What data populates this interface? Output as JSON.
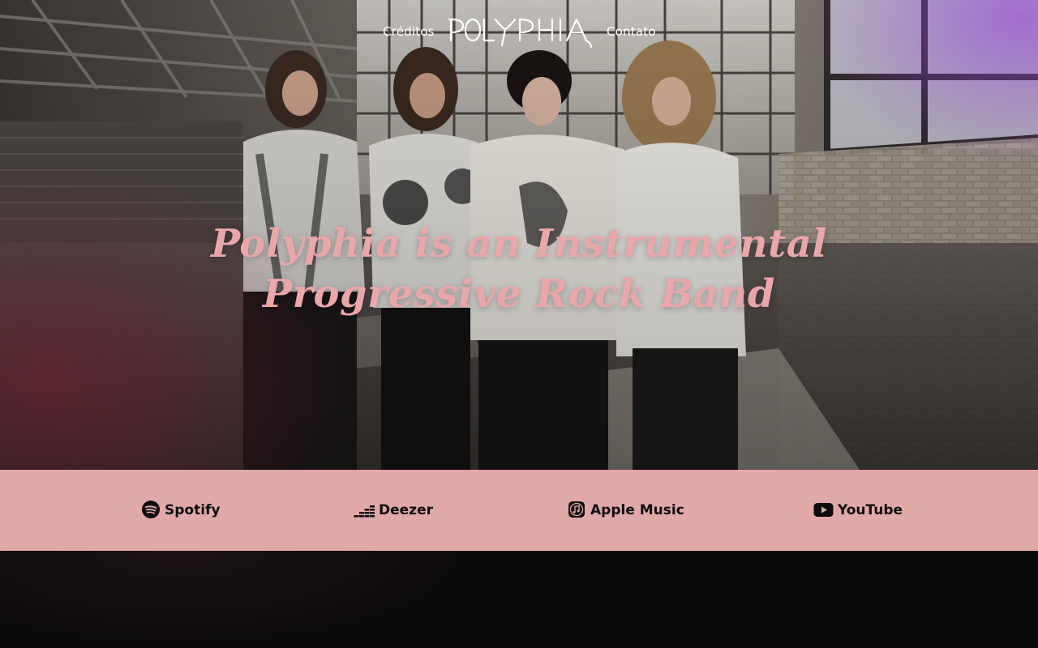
{
  "nav": {
    "left_link": "Créditos",
    "right_link": "Contato",
    "logo_text": "POLYPHIA",
    "logo_icon": "polyphia-wordmark-logo"
  },
  "hero": {
    "headline_line1": "Polyphia is an Instrumental",
    "headline_line2": "Progressive Rock Band",
    "image_alt": "band-photo"
  },
  "streaming": {
    "items": [
      {
        "label": "Spotify",
        "icon": "spotify-icon"
      },
      {
        "label": "Deezer",
        "icon": "deezer-icon"
      },
      {
        "label": "Apple Music",
        "icon": "apple-music-icon"
      },
      {
        "label": "YouTube",
        "icon": "youtube-icon"
      }
    ]
  },
  "colors": {
    "accent_pink": "#e0a9a7",
    "headline_pink": "#e8a7a8",
    "background_dark": "#0c090a",
    "nav_text": "#ffffff"
  }
}
